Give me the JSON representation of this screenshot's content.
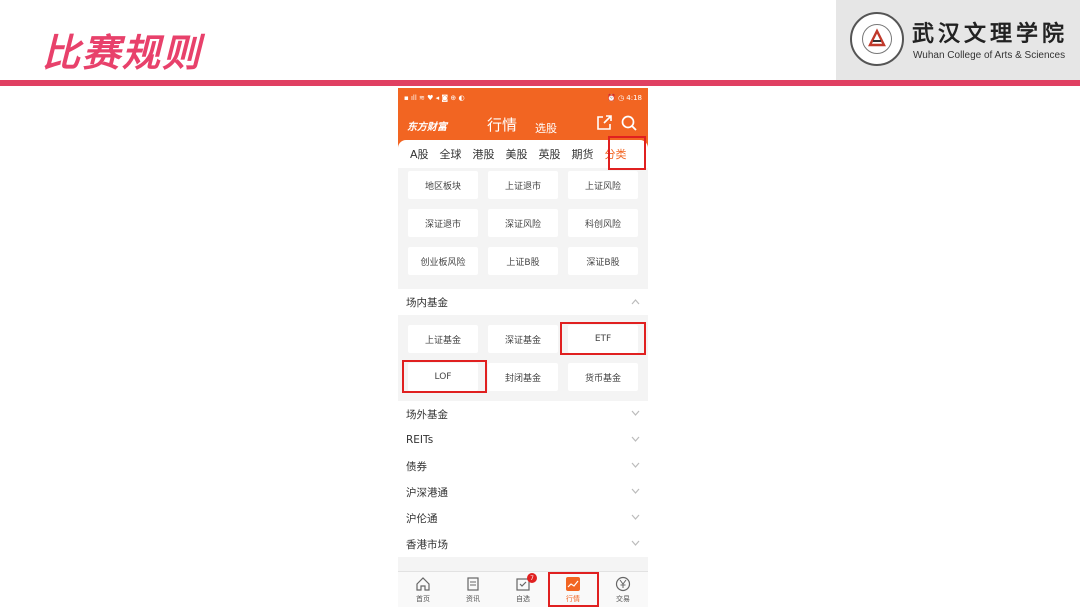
{
  "slide": {
    "title": "比赛规则",
    "university_cn": "武汉文理学院",
    "university_en": "Wuhan College of Arts & Sciences"
  },
  "colors": {
    "accent": "#f26522",
    "highlight": "#e02020",
    "slide_title": "#e8416b",
    "slide_bar": "#e04062"
  },
  "phone": {
    "status": {
      "left": "▪ ıll ≋ ♥ ◂ ◙ ⊕ ◐",
      "time": "⏰ ◷ 4:18"
    },
    "app": {
      "brand": "东方财富",
      "tab_market": "行情",
      "tab_pick": "选股",
      "icons": [
        "share-icon",
        "search-icon"
      ]
    },
    "market_tabs": [
      "A股",
      "全球",
      "港股",
      "美股",
      "英股",
      "期货",
      "分类"
    ],
    "active_tab": "分类",
    "grid_top": [
      [
        "地区板块",
        "上证退市",
        "上证风险"
      ],
      [
        "深证退市",
        "深证风险",
        "科创风险"
      ],
      [
        "创业板风险",
        "上证B股",
        "深证B股"
      ]
    ],
    "fund_section": {
      "title": "场内基金",
      "rows": [
        [
          "上证基金",
          "深证基金",
          "ETF"
        ],
        [
          "LOF",
          "封闭基金",
          "货币基金"
        ]
      ]
    },
    "collapsed_sections": [
      "场外基金",
      "REITs",
      "债券",
      "沪深港通",
      "沪伦通",
      "香港市场"
    ],
    "bottom_nav": [
      {
        "label": "首页",
        "icon": "home-icon"
      },
      {
        "label": "资讯",
        "icon": "news-icon"
      },
      {
        "label": "自选",
        "icon": "watchlist-icon",
        "badge": "7"
      },
      {
        "label": "行情",
        "icon": "market-chart-icon"
      },
      {
        "label": "交易",
        "icon": "trade-yuan-icon"
      }
    ]
  }
}
